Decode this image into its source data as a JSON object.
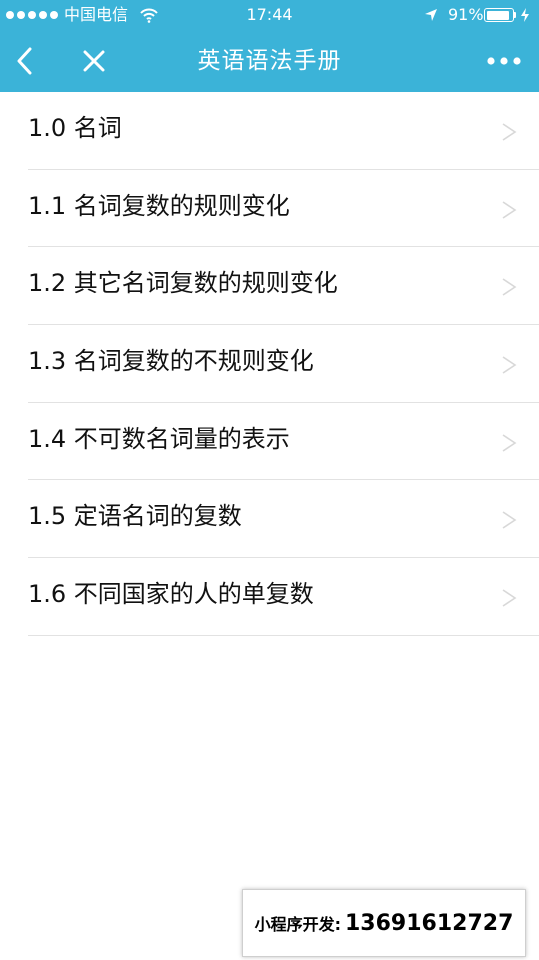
{
  "status_bar": {
    "carrier": "中国电信",
    "time": "17:44",
    "battery_percent": "91%",
    "battery_level": 0.91,
    "icons": [
      "signal-dots-icon",
      "wifi-icon",
      "location-arrow-icon",
      "battery-icon",
      "charging-bolt-icon"
    ]
  },
  "nav": {
    "title": "英语语法手册",
    "icons": [
      "back-chevron-icon",
      "close-x-icon",
      "more-dots-icon"
    ]
  },
  "colors": {
    "nav_background": "#3bb3d8",
    "nav_text": "#ffffff",
    "list_text": "#111111",
    "divider": "#e2e2e2",
    "arrow": "#d8d8d8"
  },
  "list": {
    "items": [
      {
        "label": "1.0 名词"
      },
      {
        "label": "1.1 名词复数的规则变化"
      },
      {
        "label": "1.2 其它名词复数的规则变化"
      },
      {
        "label": "1.3 名词复数的不规则变化"
      },
      {
        "label": "1.4 不可数名词量的表示"
      },
      {
        "label": "1.5 定语名词的复数"
      },
      {
        "label": "1.6 不同国家的人的单复数"
      }
    ]
  },
  "banner": {
    "label": "小程序开发:",
    "phone": "13691612727"
  }
}
